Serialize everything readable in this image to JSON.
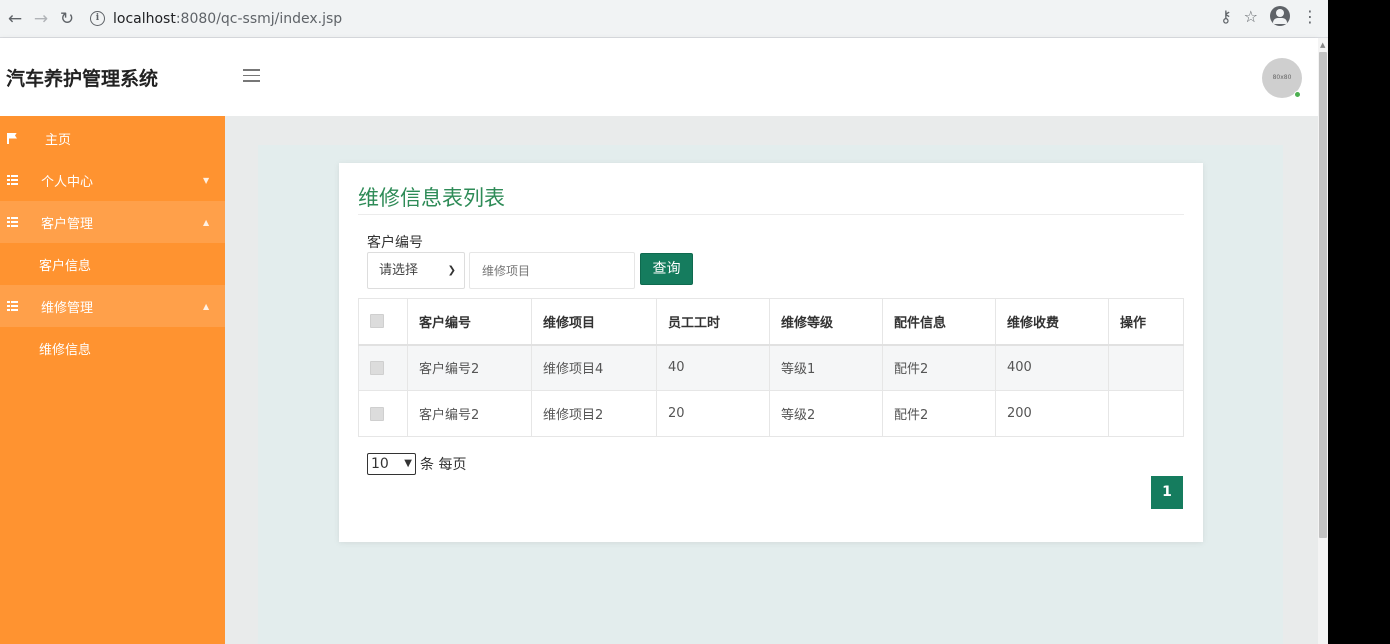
{
  "browser": {
    "url_host": "localhost",
    "url_path": ":8080/qc-ssmj/index.jsp"
  },
  "header": {
    "title": "汽车养护管理系统",
    "avatar_text": "80x80"
  },
  "sidebar": {
    "items": [
      {
        "label": "主页",
        "icon": "flag-icon"
      },
      {
        "label": "个人中心",
        "icon": "grid-icon",
        "arrow": "▼"
      },
      {
        "label": "客户管理",
        "icon": "grid-icon",
        "arrow": "▲",
        "children": [
          "客户信息"
        ]
      },
      {
        "label": "维修管理",
        "icon": "grid-icon",
        "arrow": "▲",
        "children": [
          "维修信息"
        ]
      }
    ]
  },
  "main": {
    "title": "维修信息表列表",
    "filter": {
      "label": "客户编号",
      "select_value": "请选择",
      "input_placeholder": "维修项目",
      "query_label": "查询"
    },
    "table": {
      "columns": [
        "客户编号",
        "维修项目",
        "员工工时",
        "维修等级",
        "配件信息",
        "维修收费",
        "操作"
      ],
      "rows": [
        [
          "客户编号2",
          "维修项目4",
          "40",
          "等级1",
          "配件2",
          "400",
          ""
        ],
        [
          "客户编号2",
          "维修项目2",
          "20",
          "等级2",
          "配件2",
          "200",
          ""
        ]
      ]
    },
    "pagination": {
      "page_size": "10",
      "page_size_suffix": "条 每页",
      "current_page": "1"
    }
  },
  "colors": {
    "sidebar": "#ff9330",
    "accent": "#157c5e",
    "title": "#2e8b57"
  }
}
